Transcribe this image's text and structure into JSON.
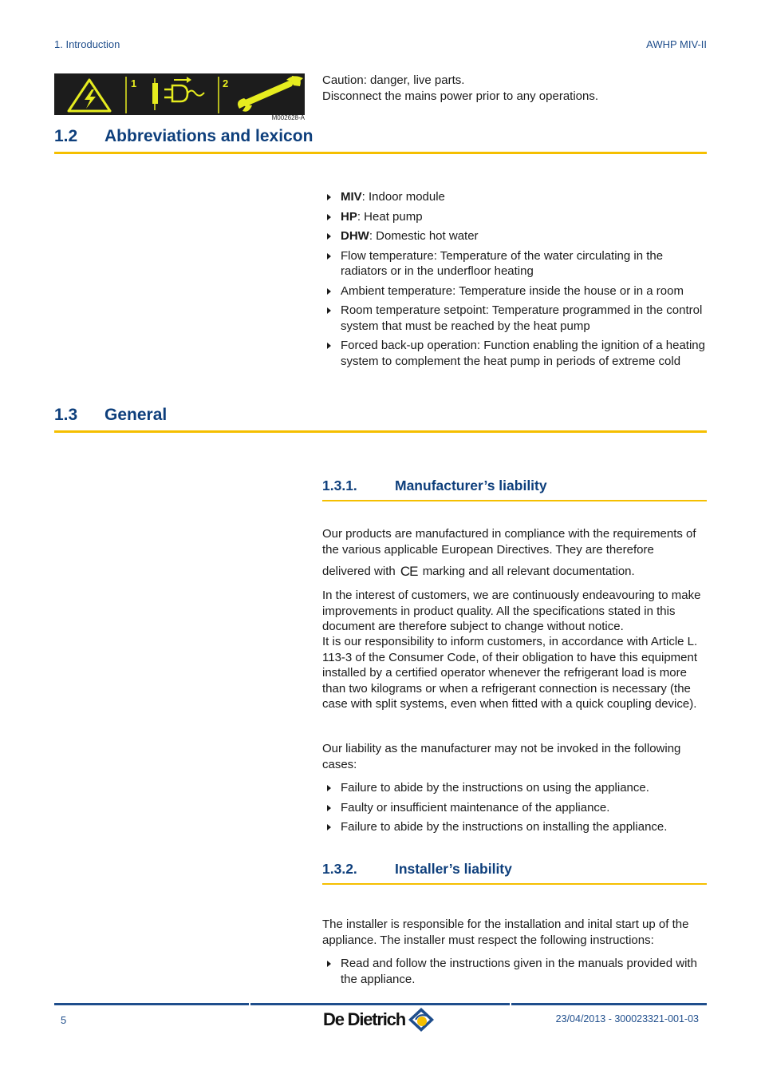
{
  "header": {
    "chapter": "1.  Introduction",
    "product": "AWHP MIV-II"
  },
  "pictogram": {
    "icons": [
      "electric-hazard-icon",
      "power-plug-icon",
      "wrench-icon"
    ],
    "step_labels": [
      "1",
      "2"
    ],
    "code": "M002628-A",
    "colors": {
      "background": "#1c1c1c",
      "symbol": "#e6ec1f"
    }
  },
  "caution": {
    "line1": "Caution: danger, live parts.",
    "line2": "Disconnect the mains power prior to any operations."
  },
  "section_1_2": {
    "number": "1.2",
    "title": "Abbreviations and lexicon",
    "items": [
      {
        "term": "MIV",
        "definition": ": Indoor module"
      },
      {
        "term": "HP",
        "definition": ": Heat pump"
      },
      {
        "term": "DHW",
        "definition": ": Domestic hot water"
      },
      {
        "term": "",
        "definition": "Flow temperature: Temperature of the water circulating in the radiators or in the underfloor heating"
      },
      {
        "term": "",
        "definition": "Ambient temperature: Temperature inside the house or in a room"
      },
      {
        "term": "",
        "definition": "Room temperature setpoint: Temperature programmed in the control system that must be reached by the heat pump"
      },
      {
        "term": "",
        "definition": "Forced back-up operation: Function enabling the ignition of a heating system to complement the heat pump in periods of extreme cold"
      }
    ]
  },
  "section_1_3": {
    "number": "1.3",
    "title": "General"
  },
  "section_1_3_1": {
    "number": "1.3.1.",
    "title": "Manufacturer’s liability",
    "para1": "Our products are manufactured in compliance with the requirements of the various applicable European Directives. They are therefore",
    "para2_before": "delivered with",
    "ce_mark": "CE",
    "para2_after": "marking and all relevant documentation.",
    "para3": "In the interest of customers, we are continuously endeavouring to make improvements in product quality. All the specifications stated in this document are therefore subject to change without notice.",
    "para4": "It is our responsibility to inform customers, in accordance with Article L. 113-3 of the Consumer Code, of their obligation to have this equipment installed by a certified operator whenever the refrigerant load is more than two kilograms or when a refrigerant connection is necessary (the case with split systems, even when fitted with a quick coupling device).",
    "para5": "Our liability as the manufacturer may not be invoked in the following cases:",
    "items": [
      "Failure to abide by the instructions on using the appliance.",
      "Faulty or insufficient maintenance of the appliance.",
      "Failure to abide by the instructions on installing the appliance."
    ]
  },
  "section_1_3_2": {
    "number": "1.3.2.",
    "title": "Installer’s liability",
    "para1": "The installer is responsible for the installation and inital start up of the appliance. The installer must respect the following instructions:",
    "items": [
      "Read and follow the instructions given in the manuals provided with the appliance."
    ]
  },
  "footer": {
    "page_number": "5",
    "brand": "De Dietrich",
    "reference": "23/04/2013 - 300023321-001-03",
    "colors": {
      "rule": "#1f4e8c",
      "logo_diamond": "#1f4e8c",
      "logo_sun": "#f5bf00"
    }
  },
  "colors": {
    "heading": "#0e3f7c",
    "rule": "#f5bf00",
    "header_text": "#1f4e8c"
  }
}
